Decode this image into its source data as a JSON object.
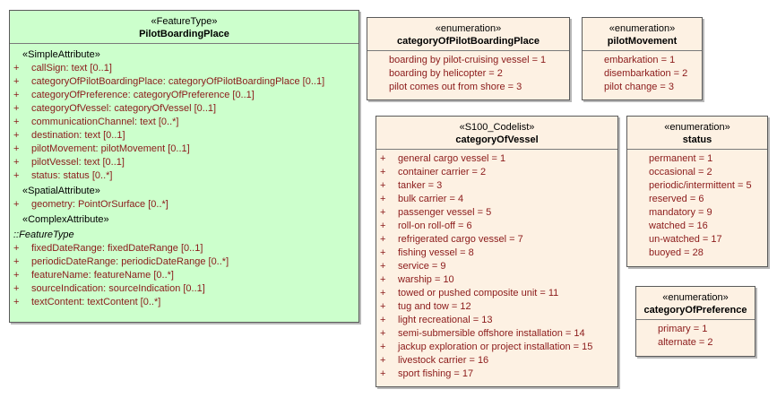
{
  "pilot_boarding_place": {
    "stereotype": "«FeatureType»",
    "name": "PilotBoardingPlace",
    "simple_label": "«SimpleAttribute»",
    "simple_attributes": [
      {
        "vis": "+",
        "text": "callSign: text [0..1]"
      },
      {
        "vis": "+",
        "text": "categoryOfPilotBoardingPlace: categoryOfPilotBoardingPlace [0..1]"
      },
      {
        "vis": "+",
        "text": "categoryOfPreference: categoryOfPreference [0..1]"
      },
      {
        "vis": "+",
        "text": "categoryOfVessel: categoryOfVessel [0..1]"
      },
      {
        "vis": "+",
        "text": "communicationChannel: text [0..*]"
      },
      {
        "vis": "+",
        "text": "destination: text [0..1]"
      },
      {
        "vis": "+",
        "text": "pilotMovement: pilotMovement [0..1]"
      },
      {
        "vis": "+",
        "text": "pilotVessel: text [0..1]"
      },
      {
        "vis": "+",
        "text": "status: status [0..*]"
      }
    ],
    "spatial_label": "«SpatialAttribute»",
    "spatial_attributes": [
      {
        "vis": "+",
        "text": "geometry: PointOrSurface [0..*]"
      }
    ],
    "complex_label": "«ComplexAttribute»",
    "inherited_label": "::FeatureType",
    "complex_attributes": [
      {
        "vis": "+",
        "text": "fixedDateRange: fixedDateRange [0..1]"
      },
      {
        "vis": "+",
        "text": "periodicDateRange: periodicDateRange [0..*]"
      },
      {
        "vis": "+",
        "text": "featureName: featureName [0..*]"
      },
      {
        "vis": "+",
        "text": "sourceIndication: sourceIndication [0..1]"
      },
      {
        "vis": "+",
        "text": "textContent: textContent [0..*]"
      }
    ]
  },
  "cat_pilot_boarding_place": {
    "stereotype": "«enumeration»",
    "name": "categoryOfPilotBoardingPlace",
    "items": [
      "boarding by pilot-cruising vessel = 1",
      "boarding by helicopter = 2",
      "pilot comes out from shore = 3"
    ]
  },
  "pilot_movement": {
    "stereotype": "«enumeration»",
    "name": "pilotMovement",
    "items": [
      "embarkation = 1",
      "disembarkation = 2",
      "pilot change = 3"
    ]
  },
  "cat_vessel": {
    "stereotype": "«S100_Codelist»",
    "name": "categoryOfVessel",
    "items": [
      {
        "vis": "+",
        "text": "general cargo vessel = 1"
      },
      {
        "vis": "+",
        "text": "container carrier = 2"
      },
      {
        "vis": "+",
        "text": "tanker = 3"
      },
      {
        "vis": "+",
        "text": "bulk carrier = 4"
      },
      {
        "vis": "+",
        "text": "passenger vessel = 5"
      },
      {
        "vis": "+",
        "text": "roll-on roll-off = 6"
      },
      {
        "vis": "+",
        "text": "refrigerated cargo vessel = 7"
      },
      {
        "vis": "+",
        "text": "fishing vessel = 8"
      },
      {
        "vis": "+",
        "text": "service = 9"
      },
      {
        "vis": "+",
        "text": "warship = 10"
      },
      {
        "vis": "+",
        "text": "towed or pushed composite unit = 11"
      },
      {
        "vis": "+",
        "text": "tug and tow = 12"
      },
      {
        "vis": "+",
        "text": "light recreational = 13"
      },
      {
        "vis": "+",
        "text": "semi-submersible offshore installation = 14"
      },
      {
        "vis": "+",
        "text": "jackup exploration or project installation = 15"
      },
      {
        "vis": "+",
        "text": "livestock carrier = 16"
      },
      {
        "vis": "+",
        "text": "sport fishing = 17"
      }
    ]
  },
  "status": {
    "stereotype": "«enumeration»",
    "name": "status",
    "items": [
      "permanent = 1",
      "occasional = 2",
      "periodic/intermittent = 5",
      "reserved = 6",
      "mandatory = 9",
      "watched = 16",
      "un-watched = 17",
      "buoyed = 28"
    ]
  },
  "cat_preference": {
    "stereotype": "«enumeration»",
    "name": "categoryOfPreference",
    "items": [
      "primary = 1",
      "alternate = 2"
    ]
  },
  "colors": {
    "feature_fill": "#ccffcc",
    "enum_fill": "#fdf1e3",
    "attribute_text": "#8b1a1a",
    "border": "#5a5a5a"
  }
}
